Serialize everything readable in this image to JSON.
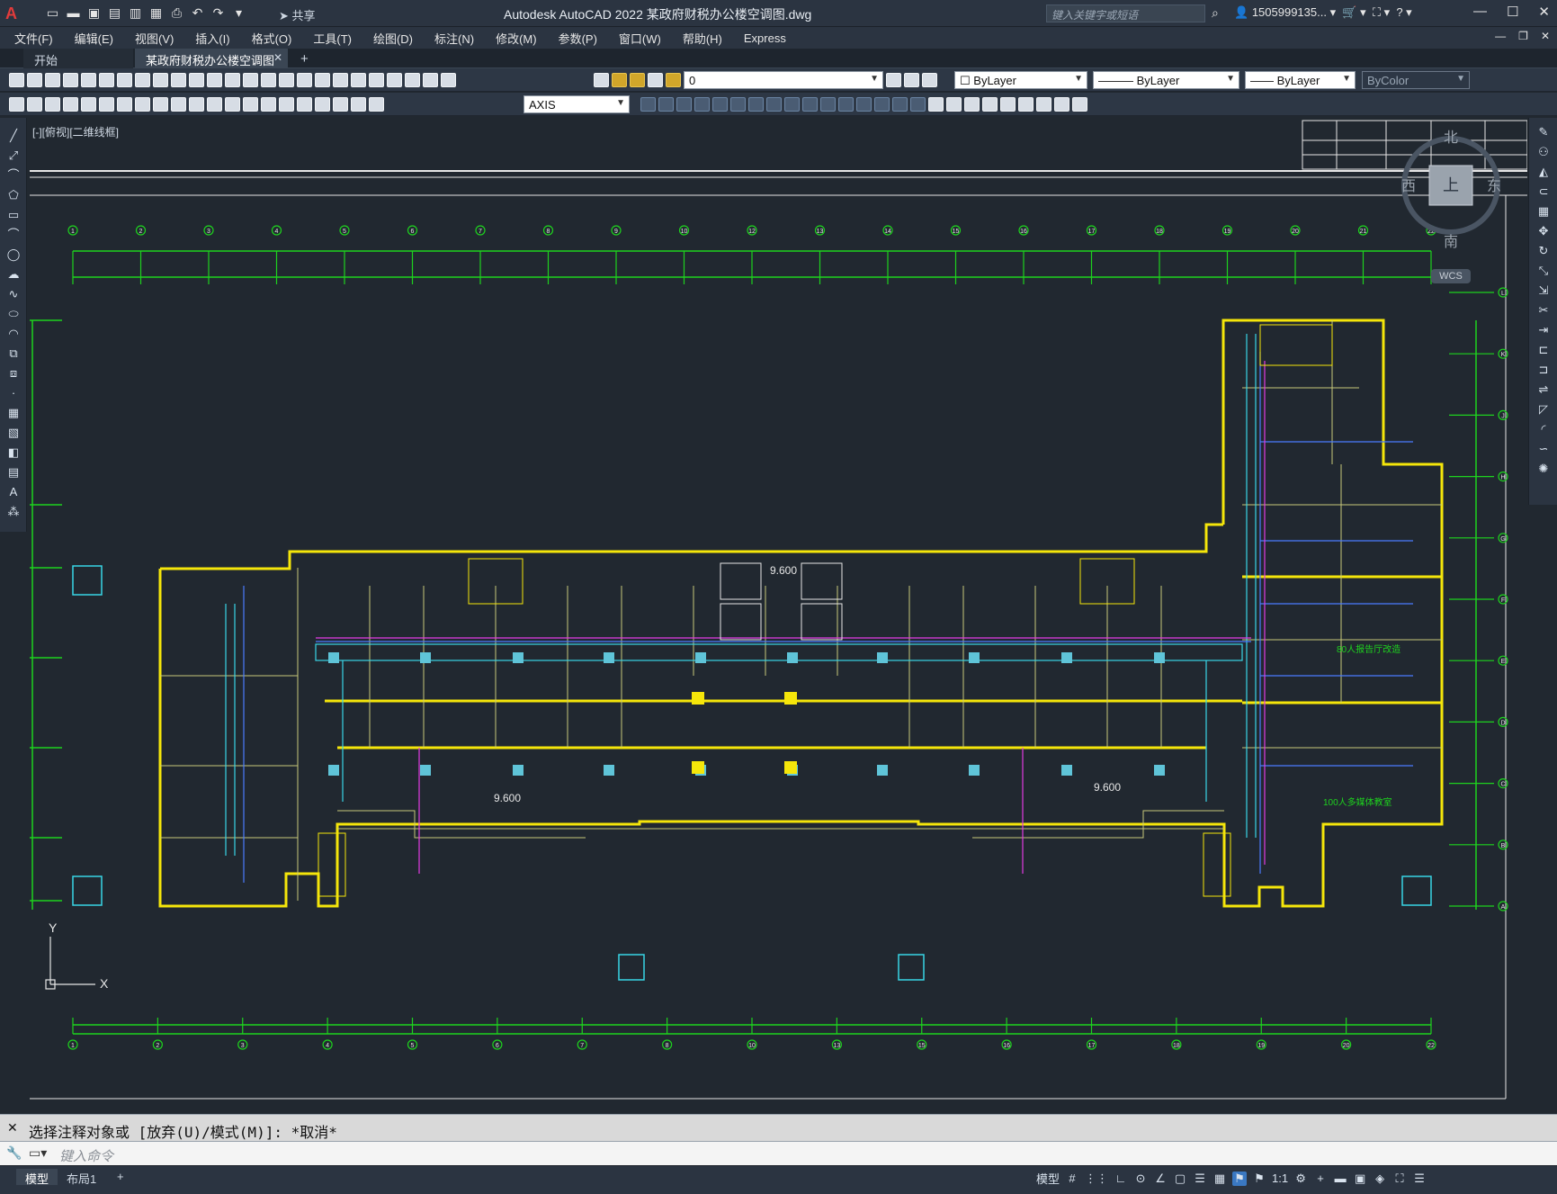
{
  "app": {
    "title": "Autodesk AutoCAD 2022    某政府财税办公楼空调图.dwg",
    "share_label": "共享",
    "search_placeholder": "键入关键字或短语",
    "user": "1505999135...",
    "logo": "A"
  },
  "menu": [
    "文件(F)",
    "编辑(E)",
    "视图(V)",
    "插入(I)",
    "格式(O)",
    "工具(T)",
    "绘图(D)",
    "标注(N)",
    "修改(M)",
    "参数(P)",
    "窗口(W)",
    "帮助(H)",
    "Express"
  ],
  "tabs": {
    "start": "开始",
    "active": "某政府财税办公楼空调图*",
    "new": "+"
  },
  "toolbar": {
    "layer": "0",
    "color": "ByLayer",
    "linetype": "ByLayer",
    "lineweight": "ByLayer",
    "plotstyle": "ByColor",
    "dimstyle": "AXIS"
  },
  "viewport": {
    "label": "[-][俯视][二维线框]",
    "compass": {
      "north": "北",
      "south": "南",
      "east": "东",
      "west": "西",
      "top": "上",
      "wcs": "WCS"
    },
    "elevation_labels": [
      "9.600",
      "9.600",
      "9.600"
    ],
    "top_axis": [
      "1",
      "2",
      "3",
      "4",
      "5",
      "6",
      "7",
      "8",
      "9",
      "10",
      "12",
      "13",
      "14",
      "15",
      "16",
      "17",
      "18",
      "19",
      "20",
      "21",
      "22"
    ],
    "bottom_axis": [
      "1",
      "2",
      "3",
      "4",
      "5",
      "6",
      "7",
      "8",
      "10",
      "13",
      "15",
      "16",
      "17",
      "18",
      "19",
      "20",
      "22"
    ],
    "right_axis": [
      "L",
      "K",
      "J",
      "H",
      "G",
      "F",
      "E",
      "D",
      "C",
      "B",
      "A"
    ],
    "room_labels": [
      "80人报告厅改造",
      "100人多媒体教室"
    ],
    "ucs": {
      "x": "X",
      "y": "Y"
    }
  },
  "command": {
    "history": "选择注释对象或 [放弃(U)/模式(M)]: *取消*",
    "placeholder": "键入命令"
  },
  "status": {
    "model_tab": "模型",
    "layout_tab": "布局1",
    "add": "+",
    "model_label": "模型",
    "scale": "1:1"
  },
  "colors": {
    "background": "#212830",
    "grid_green": "#1ed21e",
    "wall_yellow": "#f5e60a",
    "duct_cyan": "#39d6e6",
    "pipe_blue": "#4b7bff",
    "pipe_magenta": "#e23be2"
  }
}
